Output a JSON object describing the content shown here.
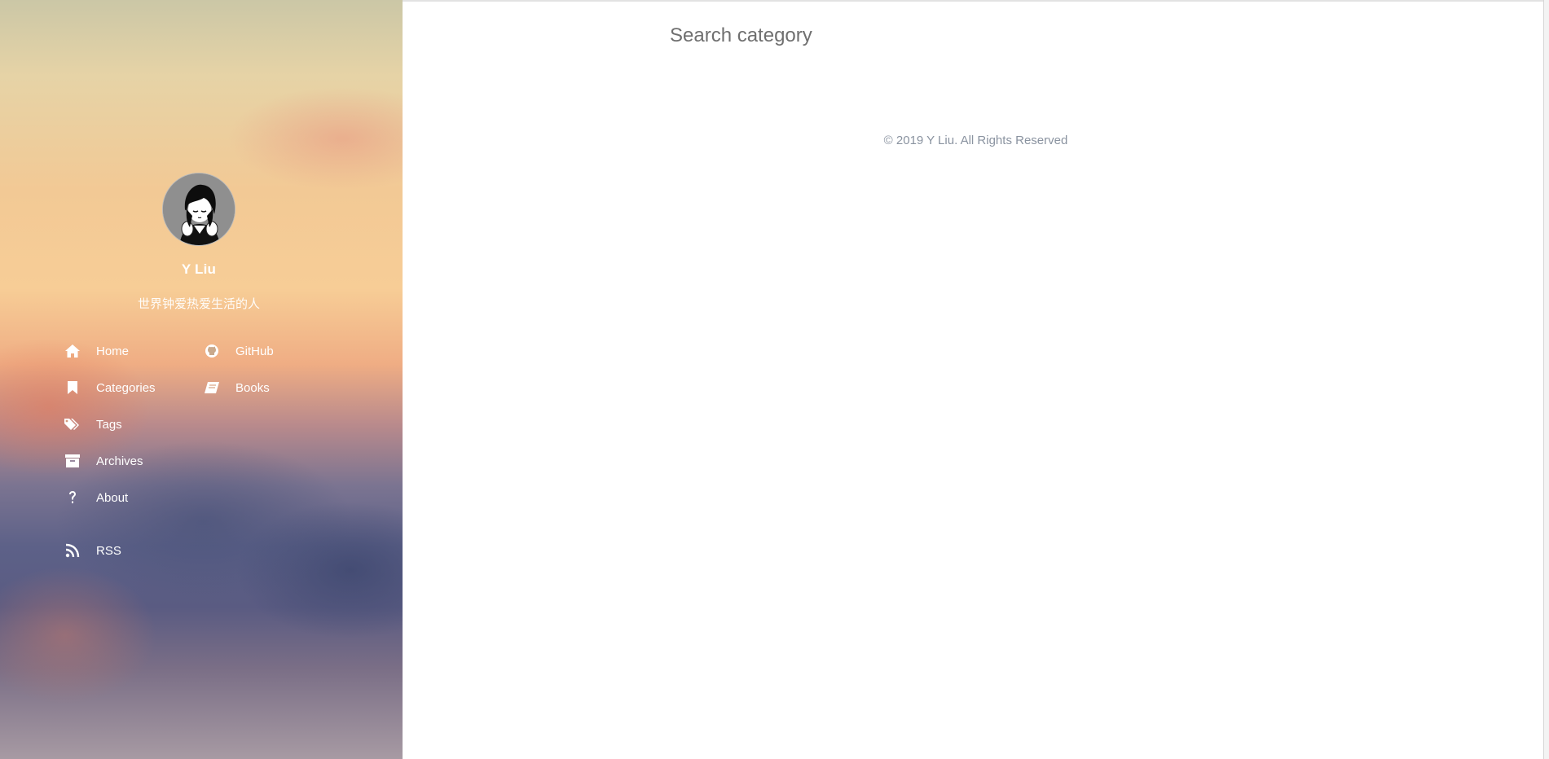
{
  "sidebar": {
    "author_name": "Y Liu",
    "bio": "世界钟爱热爱生活的人",
    "nav": [
      {
        "label": "Home",
        "icon": "home-icon"
      },
      {
        "label": "GitHub",
        "icon": "github-icon"
      },
      {
        "label": "Categories",
        "icon": "bookmark-icon"
      },
      {
        "label": "Books",
        "icon": "book-icon"
      },
      {
        "label": "Tags",
        "icon": "tags-icon"
      },
      {
        "label": "Archives",
        "icon": "archive-icon"
      },
      {
        "label": "About",
        "icon": "question-icon"
      },
      {
        "label": "RSS",
        "icon": "rss-icon"
      }
    ]
  },
  "main": {
    "search": {
      "placeholder": "Search category",
      "value": ""
    },
    "footer": "© 2019 Y Liu. All Rights Reserved"
  },
  "colors": {
    "footer_text": "#8a93a0",
    "sidebar_text": "#ffffff"
  }
}
